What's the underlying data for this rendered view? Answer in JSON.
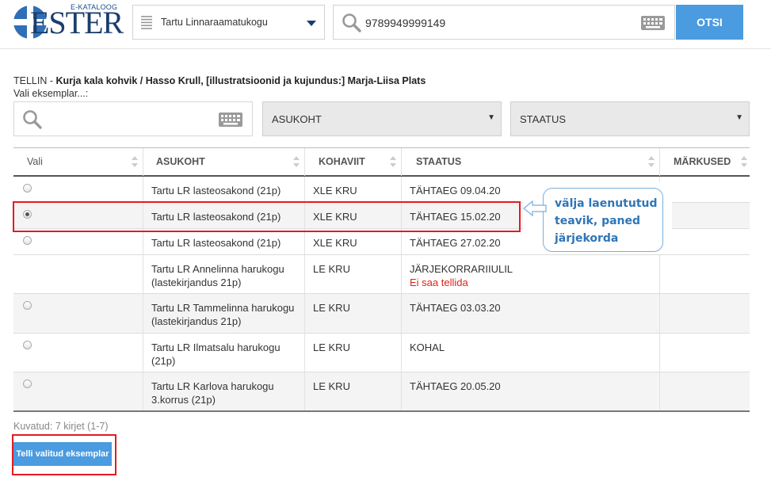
{
  "header": {
    "logo_small": "E-KATALOOG",
    "logo_big": "ESTER",
    "library_select": "Tartu Linnaraamatukogu",
    "search_value": "9789949999149",
    "search_button": "OTSI"
  },
  "order": {
    "prefix": "TELLIN - ",
    "title": "Kurja kala kohvik / Hasso Krull, [illustratsioonid ja kujundus:] Marja-Liisa Plats",
    "subtitle": "Vali eksemplar...:"
  },
  "filters": {
    "location": "ASUKOHT",
    "status": "STAATUS"
  },
  "table": {
    "headers": [
      "Vali",
      "ASUKOHT",
      "KOHAVIIT",
      "STAATUS",
      "MÄRKUSED"
    ],
    "rows": [
      {
        "location": "Tartu LR lasteosakond (21p)",
        "callno": "XLE KRU",
        "status": "TÄHTAEG 09.04.20",
        "note": ""
      },
      {
        "location": "Tartu LR lasteosakond (21p)",
        "callno": "XLE KRU",
        "status": "TÄHTAEG 15.02.20",
        "note": ""
      },
      {
        "location": "Tartu LR lasteosakond (21p)",
        "callno": "XLE KRU",
        "status": "TÄHTAEG 27.02.20",
        "note": ""
      },
      {
        "location": "Tartu LR Annelinna harukogu (lastekirjandus 21p)",
        "callno": "LE KRU",
        "status": "JÄRJEKORRARIIULIL",
        "note": "Ei saa tellida"
      },
      {
        "location": "Tartu LR Tammelinna harukogu (lastekirjandus 21p)",
        "callno": "LE KRU",
        "status": "TÄHTAEG 03.03.20",
        "note": ""
      },
      {
        "location": "Tartu LR Ilmatsalu harukogu (21p)",
        "callno": "LE KRU",
        "status": "KOHAL",
        "note": ""
      },
      {
        "location": "Tartu LR Karlova harukogu 3.korrus (21p)",
        "callno": "LE KRU",
        "status": "TÄHTAEG 20.05.20",
        "note": ""
      }
    ]
  },
  "callout": {
    "line1": "välja laenututud",
    "line2": "teavik, paned",
    "line3": "järjekorda"
  },
  "footer": {
    "count": "Kuvatud: 7 kirjet (1-7)",
    "order_button": "Telli valitud eksemplar"
  },
  "colors": {
    "accent": "#4a9be0",
    "highlight": "#e31b23",
    "logo": "#1b3d6e",
    "callout_text": "#2e75b6"
  }
}
